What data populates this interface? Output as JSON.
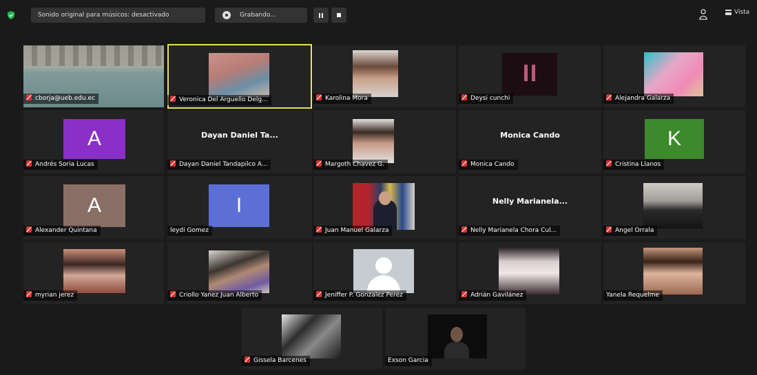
{
  "toolbar": {
    "original_audio": "Sonido original para músicos: desactivado",
    "recording": "Grabando...",
    "view": "Vista"
  },
  "colors": {
    "active_speaker": "#e6e45a",
    "muted_mic": "#d33333",
    "tile_bg": "#232323"
  },
  "participants": [
    {
      "name": "cborja@ueb.edu.ec",
      "muted": true
    },
    {
      "name": "Veronica Del Arguello Delg...",
      "muted": true,
      "active": true
    },
    {
      "name": "Karolina Mora",
      "muted": true
    },
    {
      "name": "Deysi cunchi",
      "muted": true
    },
    {
      "name": "Alejandra Galarza",
      "muted": true
    },
    {
      "name": "Andrés Soria Lucas",
      "muted": true,
      "avatar": "A",
      "avatar_color": "#8b2fc9"
    },
    {
      "name": "Dayan Daniel Tandapilco A...",
      "muted": true,
      "display": "Dayan Daniel Ta..."
    },
    {
      "name": "Margoth Chavez G.",
      "muted": true
    },
    {
      "name": "Monica Cando",
      "muted": true,
      "display": "Monica Cando"
    },
    {
      "name": "Cristina Llanos",
      "muted": true,
      "avatar": "K",
      "avatar_color": "#3d8a2c"
    },
    {
      "name": "Alexander Quintana",
      "muted": true,
      "avatar": "A",
      "avatar_color": "#8a6f66"
    },
    {
      "name": "leydi Gomez",
      "muted": false,
      "avatar": "I",
      "avatar_color": "#5b6fd6"
    },
    {
      "name": "Juan Manuel Galarza",
      "muted": true
    },
    {
      "name": "Nelly Marianela Chora Cul...",
      "muted": true,
      "display": "Nelly Marianela..."
    },
    {
      "name": "Angel Orrala",
      "muted": true
    },
    {
      "name": "myrian jerez",
      "muted": true
    },
    {
      "name": "Criollo Yanez Juan Alberto",
      "muted": true
    },
    {
      "name": "Jeniffer P. Gonzalez Perez",
      "muted": true
    },
    {
      "name": "Adrián Gavilánez",
      "muted": true
    },
    {
      "name": "Yanela Requelme",
      "muted": false
    },
    {
      "name": "Gissela Barcenes",
      "muted": true
    },
    {
      "name": "Exson Garcia",
      "muted": false
    }
  ]
}
